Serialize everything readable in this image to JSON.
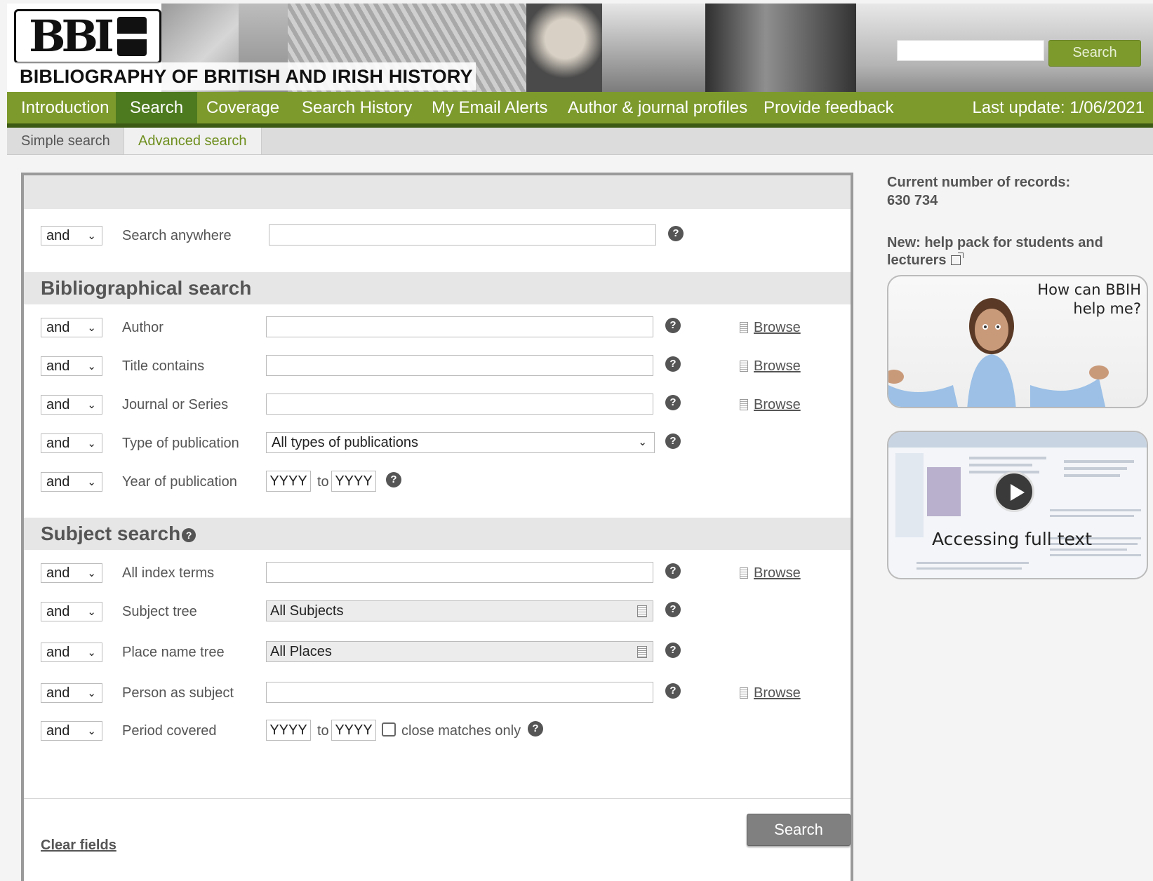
{
  "header": {
    "title": "BIBLIOGRAPHY OF BRITISH AND IRISH HISTORY",
    "search_button": "Search"
  },
  "nav": {
    "items": [
      {
        "label": "Introduction"
      },
      {
        "label": "Search",
        "active": true
      },
      {
        "label": "Coverage"
      },
      {
        "label": "Search History"
      },
      {
        "label": "My Email Alerts"
      },
      {
        "label": "Author & journal profiles"
      },
      {
        "label": "Provide feedback"
      }
    ],
    "last_update": "Last update: 1/06/2021"
  },
  "subnav": {
    "simple": "Simple search",
    "advanced": "Advanced search",
    "active": "advanced"
  },
  "form": {
    "operator": "and",
    "search_anywhere": "Search anywhere",
    "biblio_heading": "Bibliographical search",
    "author": "Author",
    "title_contains": "Title contains",
    "journal": "Journal or Series",
    "type_of_publication": "Type of publication",
    "type_value": "All types of publications",
    "year_of_publication": "Year of publication",
    "year_placeholder": "YYYY",
    "to": "to",
    "subject_heading": "Subject search",
    "index_terms": "All index terms",
    "subject_tree": "Subject tree",
    "subject_tree_value": "All Subjects",
    "place_name_tree": "Place name tree",
    "place_name_value": "All Places",
    "person_as_subject": "Person as subject",
    "period_covered": "Period covered",
    "close_matches": "close matches only",
    "browse": "Browse",
    "help": "?",
    "search_button": "Search",
    "clear_fields": "Clear fields"
  },
  "sidebar": {
    "records_label": "Current number of records:",
    "records_count": "630 734",
    "help_pack": "New: help pack for students and lecturers",
    "promo1_text": "How can BBIH help me?",
    "promo2_text": "Accessing full text"
  },
  "colors": {
    "nav_green": "#7d9a2d",
    "nav_active": "#4d7a1f",
    "accent_text": "#6f8f1f"
  }
}
